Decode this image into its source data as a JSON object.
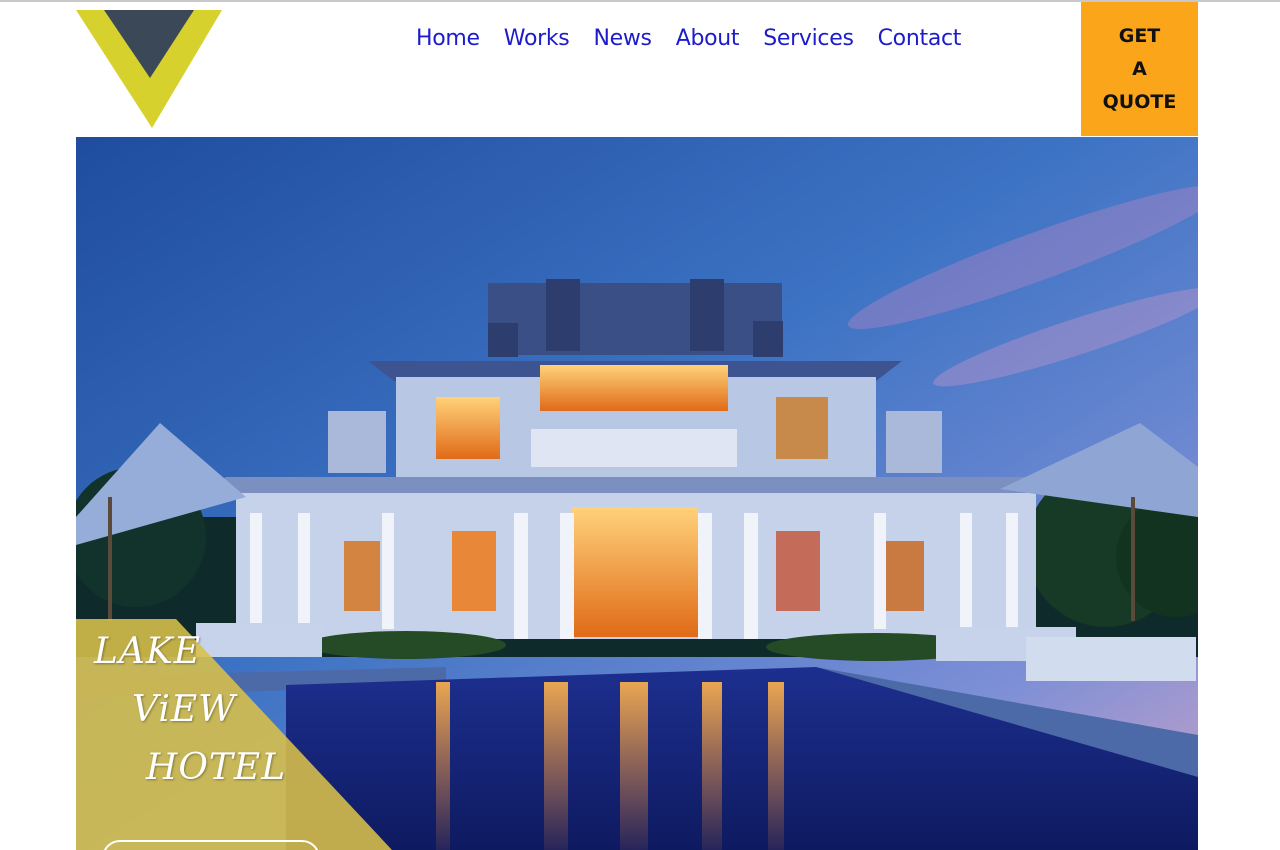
{
  "header": {
    "nav": [
      "Home",
      "Works",
      "News",
      "About",
      "Services",
      "Contact"
    ],
    "quote_button": [
      "GET",
      "A",
      "QUOTE"
    ]
  },
  "hero": {
    "caption": [
      "LAKE",
      "ViEW",
      "HOTEL"
    ],
    "button_label": ""
  },
  "colors": {
    "nav_link": "#1c1ccc",
    "quote_bg": "#fba51a",
    "logo_yellow": "#d6d12c",
    "logo_slate": "#3b4858",
    "overlay_gold": "#d9c04a"
  }
}
